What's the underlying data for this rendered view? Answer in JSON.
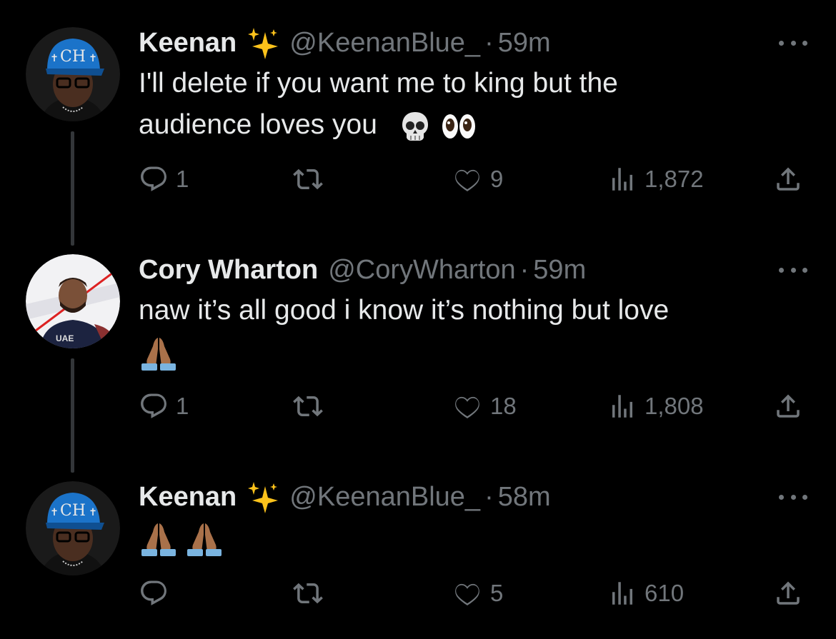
{
  "tweets": [
    {
      "name": "Keenan",
      "handle": "@KeenanBlue_",
      "separator": "·",
      "time": "59m",
      "lines": [
        "I'll delete if you want me to king but the",
        "audience loves you"
      ],
      "emojis": [
        "skull-emoji",
        "eyes-emoji"
      ],
      "replies": "1",
      "retweets": "",
      "likes": "9",
      "views": "1,872"
    },
    {
      "name": "Cory Wharton",
      "handle": "@CoryWharton",
      "separator": "·",
      "time": "59m",
      "lines": [
        "naw it’s all good i know it’s nothing but love"
      ],
      "emojis": [
        "folded-hands-emoji"
      ],
      "replies": "1",
      "retweets": "",
      "likes": "18",
      "views": "1,808"
    },
    {
      "name": "Keenan",
      "handle": "@KeenanBlue_",
      "separator": "·",
      "time": "58m",
      "lines": [],
      "emojis": [
        "folded-hands-emoji",
        "folded-hands-emoji"
      ],
      "replies": "",
      "retweets": "",
      "likes": "5",
      "views": "610"
    }
  ],
  "colors": {
    "background": "#000000",
    "text": "#e7e9ea",
    "secondary": "#71767b",
    "thread_line": "#333639"
  }
}
